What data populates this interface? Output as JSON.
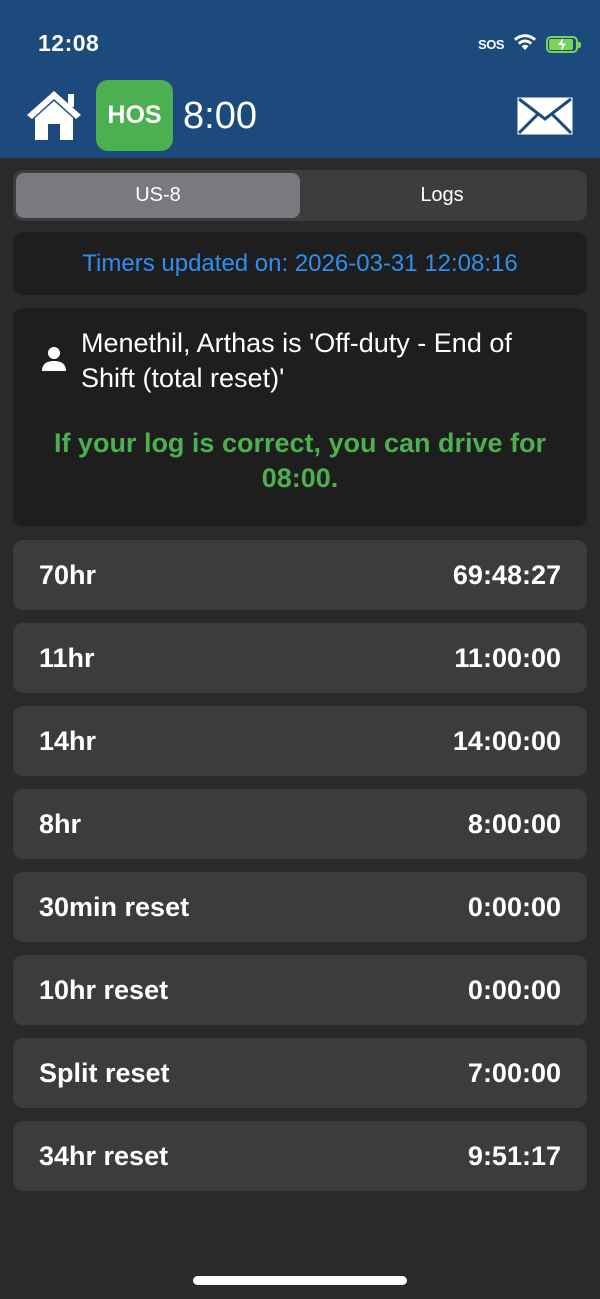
{
  "status_bar": {
    "time": "12:08",
    "sos": "SOS",
    "icons": [
      "wifi-icon",
      "battery-charging-icon"
    ]
  },
  "header": {
    "home_icon": "home-icon",
    "hos_label": "HOS",
    "hos_time": "8:00",
    "mail_icon": "mail-icon",
    "colors": {
      "bar": "#1c4a7d",
      "hos_badge": "#4caf50"
    }
  },
  "tabs": [
    {
      "label": "US-8",
      "selected": true
    },
    {
      "label": "Logs",
      "selected": false
    }
  ],
  "timers_updated": "Timers updated on: 2026-03-31 12:08:16",
  "driver_status": {
    "icon": "person-icon",
    "text": "Menethil, Arthas is 'Off-duty - End of Shift (total reset)'",
    "drive_message": "If your log is correct, you can drive for 08:00."
  },
  "timers": [
    {
      "label": "70hr",
      "value": "69:48:27"
    },
    {
      "label": "11hr",
      "value": "11:00:00"
    },
    {
      "label": "14hr",
      "value": "14:00:00"
    },
    {
      "label": "8hr",
      "value": "8:00:00"
    },
    {
      "label": "30min reset",
      "value": "0:00:00"
    },
    {
      "label": "10hr reset",
      "value": "0:00:00"
    },
    {
      "label": "Split reset",
      "value": "7:00:00"
    },
    {
      "label": "34hr reset",
      "value": "9:51:17"
    }
  ]
}
